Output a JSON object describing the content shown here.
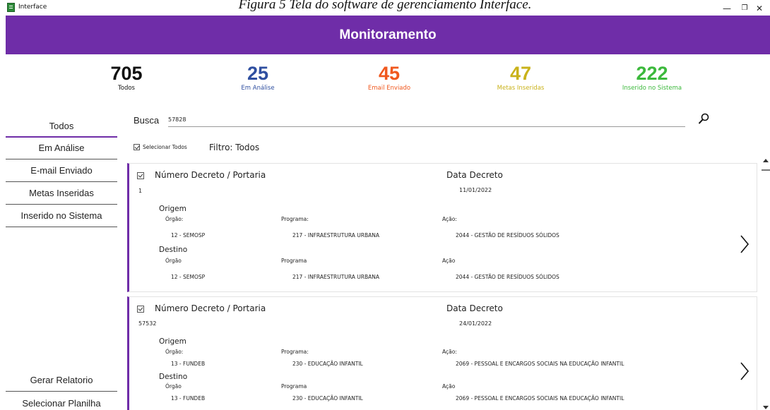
{
  "caption": "Figura 5 Tela do software de gerenciamento Interface.",
  "window": {
    "title": "Interface",
    "minimize": "—",
    "maximize": "❐",
    "close": "✕"
  },
  "header": {
    "title": "Monitoramento"
  },
  "stats": [
    {
      "value": "705",
      "label": "Todos",
      "color": "#111111"
    },
    {
      "value": "25",
      "label": "Em Análise",
      "color": "#2f4fa0"
    },
    {
      "value": "45",
      "label": "Email Enviado",
      "color": "#f0581e"
    },
    {
      "value": "47",
      "label": "Metas Inseridas",
      "color": "#c9b21a"
    },
    {
      "value": "222",
      "label": "Inserido no Sistema",
      "color": "#3cb93c"
    }
  ],
  "sidebar": {
    "items": [
      {
        "label": "Todos"
      },
      {
        "label": "Em Análise"
      },
      {
        "label": "E-mail Enviado"
      },
      {
        "label": "Metas Inseridas"
      },
      {
        "label": "Inserido no Sistema"
      }
    ],
    "bottom": [
      {
        "label": "Gerar Relatorio"
      },
      {
        "label": "Selecionar Planilha"
      }
    ]
  },
  "search": {
    "label": "Busca",
    "value": "57828"
  },
  "select_all_label": "Selecionar Todos",
  "filter_label": "Filtro: Todos",
  "records": [
    {
      "number_header": "Número Decreto / Portaria",
      "number": "1",
      "date_header": "Data Decreto",
      "date": "11/01/2022",
      "origem": {
        "title": "Origem",
        "orgao_label": "Órgão:",
        "programa_label": "Programa:",
        "acao_label": "Ação:",
        "orgao": "12 - SEMOSP",
        "programa": "217 - INFRAESTRUTURA URBANA",
        "acao": "2044 - GESTÃO DE RESÍDUOS SÓLIDOS"
      },
      "destino": {
        "title": "Destino",
        "orgao_label": "Órgão",
        "programa_label": "Programa",
        "acao_label": "Ação",
        "orgao": "12 - SEMOSP",
        "programa": "217 - INFRAESTRUTURA URBANA",
        "acao": "2044 - GESTÃO DE RESÍDUOS SÓLIDOS"
      }
    },
    {
      "number_header": "Número Decreto / Portaria",
      "number": "57532",
      "date_header": "Data Decreto",
      "date": "24/01/2022",
      "origem": {
        "title": "Origem",
        "orgao_label": "Órgão:",
        "programa_label": "Programa:",
        "acao_label": "Ação:",
        "orgao": "13 - FUNDEB",
        "programa": "230 - EDUCAÇÃO INFANTIL",
        "acao": "2069 - PESSOAL E ENCARGOS SOCIAIS NA EDUCAÇÃO INFANTIL"
      },
      "destino": {
        "title": "Destino",
        "orgao_label": "Órgão",
        "programa_label": "Programa",
        "acao_label": "Ação",
        "orgao": "13 - FUNDEB",
        "programa": "230 - EDUCAÇÃO INFANTIL",
        "acao": "2069 - PESSOAL E ENCARGOS SOCIAIS NA EDUCAÇÃO INFANTIL"
      }
    }
  ],
  "theme": {
    "accent": "#6f2da8"
  }
}
